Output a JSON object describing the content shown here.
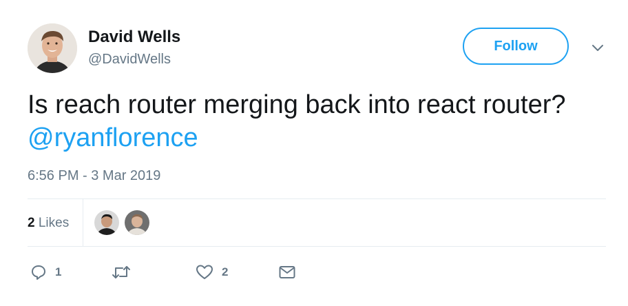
{
  "author": {
    "name": "David Wells",
    "handle": "@DavidWells"
  },
  "follow_button": {
    "label": "Follow"
  },
  "tweet": {
    "text": "Is reach router merging back into react router? ",
    "mention": "@ryanflorence",
    "timestamp": "6:56 PM - 3 Mar 2019"
  },
  "stats": {
    "likes_count": "2",
    "likes_label": " Likes"
  },
  "actions": {
    "reply_count": "1",
    "like_count": "2"
  },
  "colors": {
    "accent": "#1da1f2",
    "muted": "#657786",
    "text": "#14171a",
    "divider": "#e6ecf0"
  }
}
